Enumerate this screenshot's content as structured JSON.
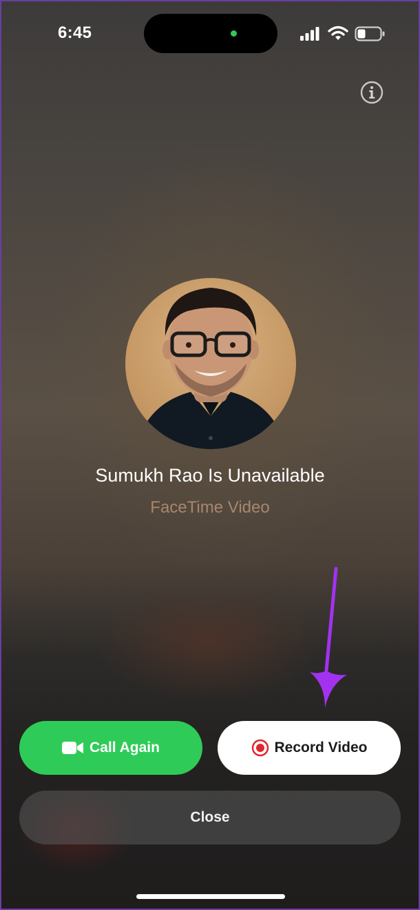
{
  "status_bar": {
    "time": "6:45"
  },
  "contact": {
    "name_line": "Sumukh Rao Is Unavailable",
    "call_type": "FaceTime Video"
  },
  "actions": {
    "call_again": "Call Again",
    "record_video": "Record Video",
    "close": "Close"
  },
  "icons": {
    "signal": "cellular-signal-icon",
    "wifi": "wifi-icon",
    "battery": "battery-icon",
    "info": "info-icon",
    "video": "video-camera-icon",
    "record": "record-icon"
  },
  "colors": {
    "call_again_bg": "#2fcb58",
    "record_dot": "#e0262d",
    "annotation_arrow": "#a232f0",
    "privacy_indicator": "#34c759"
  }
}
